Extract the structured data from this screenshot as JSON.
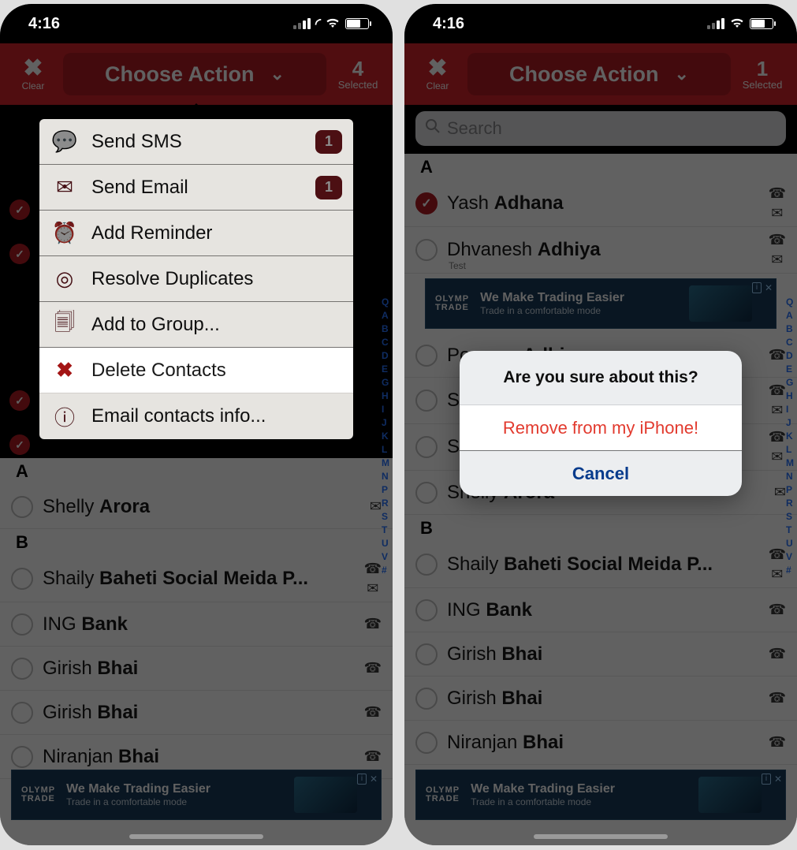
{
  "status": {
    "time": "4:16"
  },
  "header": {
    "clear_label": "Clear",
    "choose_action": "Choose Action",
    "left_selected_count": "4",
    "right_selected_count": "1",
    "selected_label": "Selected"
  },
  "search": {
    "placeholder": "Search"
  },
  "index_letters": [
    "Q",
    "A",
    "B",
    "C",
    "D",
    "E",
    "G",
    "H",
    "I",
    "J",
    "K",
    "L",
    "M",
    "N",
    "P",
    "R",
    "S",
    "T",
    "U",
    "V",
    "#"
  ],
  "action_menu": {
    "items": [
      {
        "icon": "sms-icon",
        "label": "Send SMS",
        "count": "1"
      },
      {
        "icon": "mail-icon",
        "label": "Send Email",
        "count": "1"
      },
      {
        "icon": "clock-icon",
        "label": "Add Reminder"
      },
      {
        "icon": "duplicates-icon",
        "label": "Resolve Duplicates"
      },
      {
        "icon": "copy-icon",
        "label": "Add to Group..."
      },
      {
        "icon": "x-icon",
        "label": "Delete Contacts",
        "highlight": true
      },
      {
        "icon": "info-icon",
        "label": "Email contacts info..."
      }
    ]
  },
  "alert": {
    "title": "Are you sure about this?",
    "remove": "Remove from my iPhone!",
    "cancel": "Cancel"
  },
  "ad": {
    "brand_top": "OLYMP",
    "brand_bottom": "TRADE",
    "line1": "We Make Trading Easier",
    "line2": "Trade in a comfortable mode"
  },
  "contacts_left": {
    "sections": [
      {
        "letter": "A",
        "rows": [
          {
            "first": "Shelly",
            "last": "Arora",
            "badges": [
              "mail"
            ]
          }
        ]
      },
      {
        "letter": "B",
        "rows": [
          {
            "first": "Shaily",
            "last": "Baheti Social Meida P...",
            "badges": [
              "phone",
              "mail"
            ]
          },
          {
            "first": "ING",
            "last": "Bank",
            "badges": [
              "phone"
            ]
          },
          {
            "first": "Girish",
            "last": "Bhai",
            "badges": [
              "phone"
            ]
          },
          {
            "first": "Girish",
            "last": "Bhai",
            "badges": [
              "phone"
            ]
          },
          {
            "first": "Niranjan",
            "last": "Bhai",
            "badges": [
              "phone"
            ]
          }
        ]
      }
    ]
  },
  "contacts_right": {
    "sections": [
      {
        "letter": "A",
        "rows": [
          {
            "first": "Yash",
            "last": "Adhana",
            "selected": true,
            "badges": [
              "phone",
              "mail"
            ]
          },
          {
            "first": "Dhvanesh",
            "last": "Adhiya",
            "sub": "Test",
            "badges": [
              "phone",
              "mail"
            ]
          },
          {
            "ad": true
          },
          {
            "first": "Poonam",
            "last": "Adhiya",
            "badges": [
              "phone"
            ]
          },
          {
            "first": "S",
            "last": "",
            "badges": [
              "phone",
              "mail"
            ]
          },
          {
            "first": "S",
            "last": "",
            "badges": [
              "phone",
              "mail"
            ]
          },
          {
            "first": "Shelly",
            "last": "Arora",
            "badges": [
              "mail"
            ]
          }
        ]
      },
      {
        "letter": "B",
        "rows": [
          {
            "first": "Shaily",
            "last": "Baheti Social Meida P...",
            "badges": [
              "phone",
              "mail"
            ]
          },
          {
            "first": "ING",
            "last": "Bank",
            "badges": [
              "phone"
            ]
          },
          {
            "first": "Girish",
            "last": "Bhai",
            "badges": [
              "phone"
            ]
          },
          {
            "first": "Girish",
            "last": "Bhai",
            "badges": [
              "phone"
            ]
          },
          {
            "first": "Niranjan",
            "last": "Bhai",
            "badges": [
              "phone"
            ]
          }
        ]
      }
    ]
  }
}
